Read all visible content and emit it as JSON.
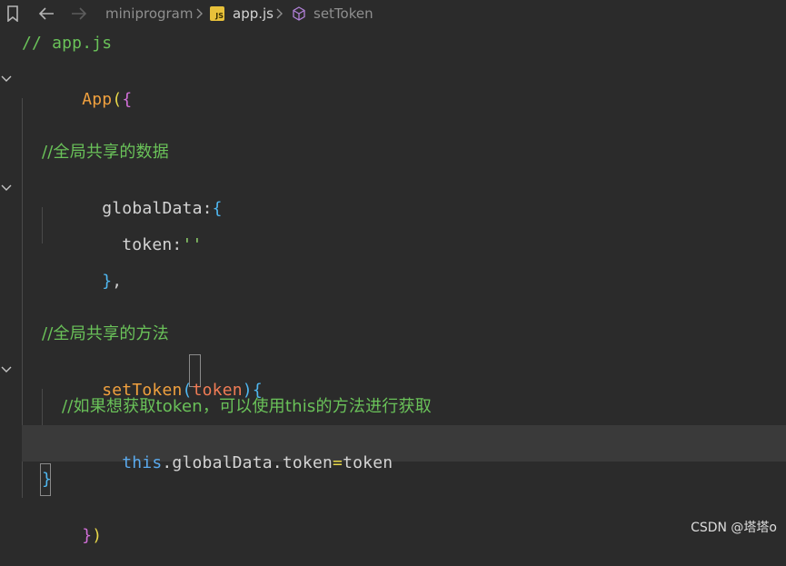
{
  "breadcrumb": {
    "folder": "miniprogram",
    "file": "app.js",
    "file_badge": "JS",
    "symbol": "setToken"
  },
  "code": {
    "line1_comment": "// app.js",
    "line2_fn": "App",
    "line2_paren": "(",
    "line2_brace": "{",
    "line4_comment": "//全局共享的数据",
    "line5_prop": "globalData",
    "line5_colon": ":",
    "line5_brace": "{",
    "line6_prop": "token",
    "line6_colon": ":",
    "line6_str": "''",
    "line7_brace": "}",
    "line7_comma": ",",
    "line9_comment": "//全局共享的方法",
    "line10_fn": "setToken",
    "line10_open": "(",
    "line10_param": "token",
    "line10_close": ")",
    "line10_brace": "{",
    "line11_comment": "//如果想获取token，可以使用this的方法进行获取",
    "line12_this": "this",
    "line12_rest": ".globalData.token",
    "line12_eq": "=",
    "line12_val": "token",
    "line13_brace": "}",
    "line14_brace": "}",
    "line14_paren": ")"
  },
  "watermark": "CSDN @塔塔o",
  "icons": [
    "bookmark-icon",
    "back-arrow-icon",
    "forward-arrow-icon",
    "chevron-right-icon",
    "js-file-icon",
    "method-cube-icon",
    "fold-chevron-icon"
  ]
}
